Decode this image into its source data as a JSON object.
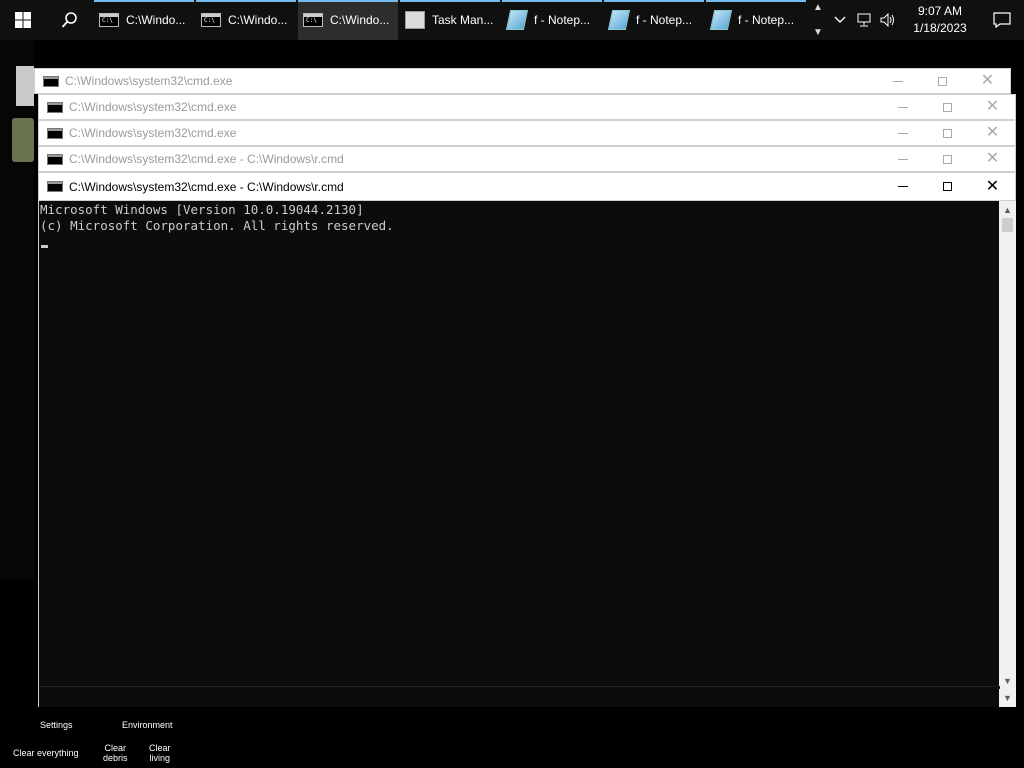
{
  "taskbar": {
    "items": [
      {
        "label": "C:\\Windo...",
        "icon": "cmd-icon",
        "active": false
      },
      {
        "label": "C:\\Windo...",
        "icon": "cmd-icon",
        "active": false
      },
      {
        "label": "C:\\Windo...",
        "icon": "cmd-icon",
        "active": true
      },
      {
        "label": "Task Man...",
        "icon": "task-manager-icon",
        "active": false
      },
      {
        "label": "f - Notep...",
        "icon": "notepad-icon",
        "active": false
      },
      {
        "label": "f - Notep...",
        "icon": "notepad-icon",
        "active": false
      },
      {
        "label": "f - Notep...",
        "icon": "notepad-icon",
        "active": false
      }
    ],
    "clock": {
      "time": "9:07 AM",
      "date": "1/18/2023"
    },
    "accent": "#76b9ed"
  },
  "windows": [
    {
      "title": "C:\\Windows\\system32\\cmd.exe",
      "active": false
    },
    {
      "title": "C:\\Windows\\system32\\cmd.exe",
      "active": false
    },
    {
      "title": "C:\\Windows\\system32\\cmd.exe",
      "active": false
    },
    {
      "title": "C:\\Windows\\system32\\cmd.exe - C:\\Windows\\r.cmd",
      "active": false
    },
    {
      "title": "C:\\Windows\\system32\\cmd.exe - C:\\Windows\\r.cmd",
      "active": true
    }
  ],
  "console": {
    "line1": "Microsoft Windows [Version 10.0.19044.2130]",
    "line2": "(c) Microsoft Corporation. All rights reserved."
  },
  "overlay": {
    "settings": "Settings",
    "environment": "Environment",
    "clear_everything": "Clear everything",
    "clear_debris_1": "Clear",
    "clear_debris_2": "debris",
    "clear_living_1": "Clear",
    "clear_living_2": "living"
  }
}
